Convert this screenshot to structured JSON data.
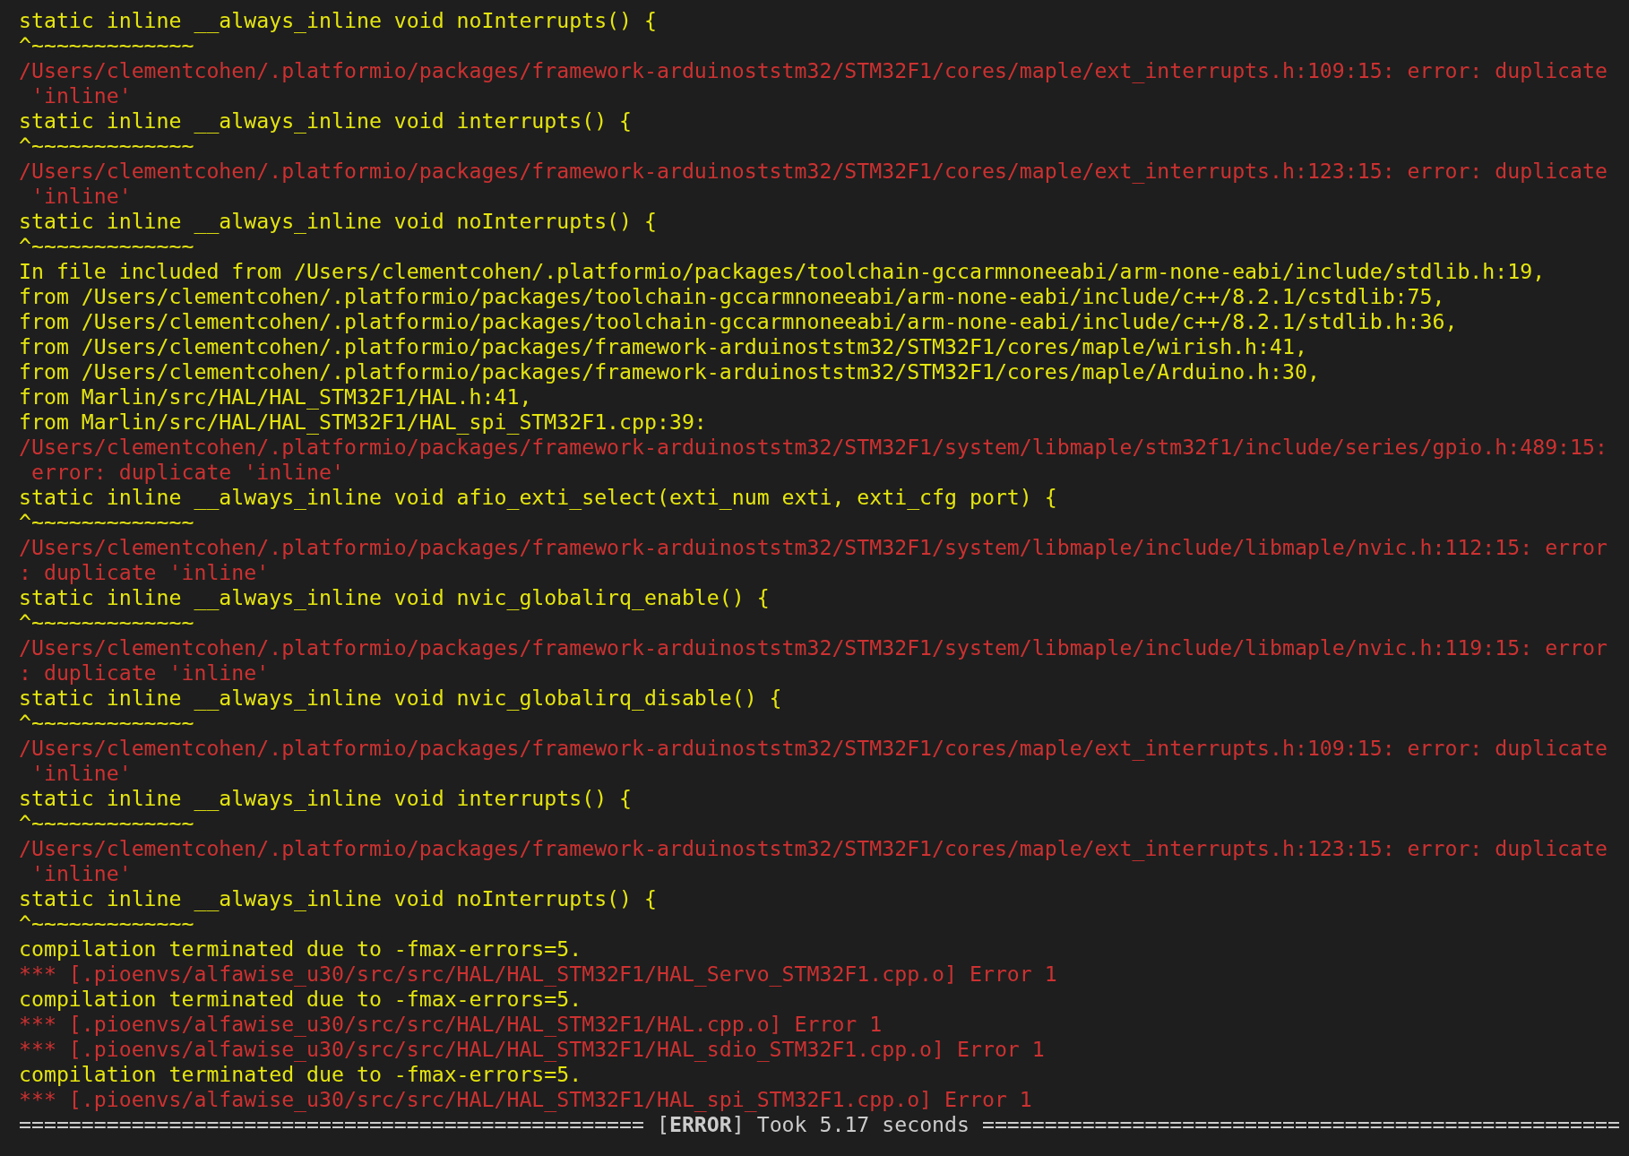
{
  "terminal": {
    "lines": [
      {
        "kind": "code",
        "text": "static inline __always_inline void noInterrupts() {"
      },
      {
        "kind": "code",
        "text": "^~~~~~~~~~~~~~"
      },
      {
        "kind": "error",
        "text": "/Users/clementcohen/.platformio/packages/framework-arduinoststm32/STM32F1/cores/maple/ext_interrupts.h:109:15: error: duplicate"
      },
      {
        "kind": "error",
        "text": " 'inline'"
      },
      {
        "kind": "code",
        "text": "static inline __always_inline void interrupts() {"
      },
      {
        "kind": "code",
        "text": "^~~~~~~~~~~~~~"
      },
      {
        "kind": "error",
        "text": "/Users/clementcohen/.platformio/packages/framework-arduinoststm32/STM32F1/cores/maple/ext_interrupts.h:123:15: error: duplicate"
      },
      {
        "kind": "error",
        "text": " 'inline'"
      },
      {
        "kind": "code",
        "text": "static inline __always_inline void noInterrupts() {"
      },
      {
        "kind": "code",
        "text": "^~~~~~~~~~~~~~"
      },
      {
        "kind": "code",
        "text": "In file included from /Users/clementcohen/.platformio/packages/toolchain-gccarmnoneeabi/arm-none-eabi/include/stdlib.h:19,"
      },
      {
        "kind": "code",
        "text": "from /Users/clementcohen/.platformio/packages/toolchain-gccarmnoneeabi/arm-none-eabi/include/c++/8.2.1/cstdlib:75,"
      },
      {
        "kind": "code",
        "text": "from /Users/clementcohen/.platformio/packages/toolchain-gccarmnoneeabi/arm-none-eabi/include/c++/8.2.1/stdlib.h:36,"
      },
      {
        "kind": "code",
        "text": "from /Users/clementcohen/.platformio/packages/framework-arduinoststm32/STM32F1/cores/maple/wirish.h:41,"
      },
      {
        "kind": "code",
        "text": "from /Users/clementcohen/.platformio/packages/framework-arduinoststm32/STM32F1/cores/maple/Arduino.h:30,"
      },
      {
        "kind": "code",
        "text": "from Marlin/src/HAL/HAL_STM32F1/HAL.h:41,"
      },
      {
        "kind": "code",
        "text": "from Marlin/src/HAL/HAL_STM32F1/HAL_spi_STM32F1.cpp:39:"
      },
      {
        "kind": "error",
        "text": "/Users/clementcohen/.platformio/packages/framework-arduinoststm32/STM32F1/system/libmaple/stm32f1/include/series/gpio.h:489:15:"
      },
      {
        "kind": "error",
        "text": " error: duplicate 'inline'"
      },
      {
        "kind": "code",
        "text": "static inline __always_inline void afio_exti_select(exti_num exti, exti_cfg port) {"
      },
      {
        "kind": "code",
        "text": "^~~~~~~~~~~~~~"
      },
      {
        "kind": "error",
        "text": "/Users/clementcohen/.platformio/packages/framework-arduinoststm32/STM32F1/system/libmaple/include/libmaple/nvic.h:112:15: error"
      },
      {
        "kind": "error",
        "text": ": duplicate 'inline'"
      },
      {
        "kind": "code",
        "text": "static inline __always_inline void nvic_globalirq_enable() {"
      },
      {
        "kind": "code",
        "text": "^~~~~~~~~~~~~~"
      },
      {
        "kind": "error",
        "text": "/Users/clementcohen/.platformio/packages/framework-arduinoststm32/STM32F1/system/libmaple/include/libmaple/nvic.h:119:15: error"
      },
      {
        "kind": "error",
        "text": ": duplicate 'inline'"
      },
      {
        "kind": "code",
        "text": "static inline __always_inline void nvic_globalirq_disable() {"
      },
      {
        "kind": "code",
        "text": "^~~~~~~~~~~~~~"
      },
      {
        "kind": "error",
        "text": "/Users/clementcohen/.platformio/packages/framework-arduinoststm32/STM32F1/cores/maple/ext_interrupts.h:109:15: error: duplicate"
      },
      {
        "kind": "error",
        "text": " 'inline'"
      },
      {
        "kind": "code",
        "text": "static inline __always_inline void interrupts() {"
      },
      {
        "kind": "code",
        "text": "^~~~~~~~~~~~~~"
      },
      {
        "kind": "error",
        "text": "/Users/clementcohen/.platformio/packages/framework-arduinoststm32/STM32F1/cores/maple/ext_interrupts.h:123:15: error: duplicate"
      },
      {
        "kind": "error",
        "text": " 'inline'"
      },
      {
        "kind": "code",
        "text": "static inline __always_inline void noInterrupts() {"
      },
      {
        "kind": "code",
        "text": "^~~~~~~~~~~~~~"
      },
      {
        "kind": "code",
        "text": "compilation terminated due to -fmax-errors=5."
      },
      {
        "kind": "error",
        "text": "*** [.pioenvs/alfawise_u30/src/src/HAL/HAL_STM32F1/HAL_Servo_STM32F1.cpp.o] Error 1"
      },
      {
        "kind": "code",
        "text": "compilation terminated due to -fmax-errors=5."
      },
      {
        "kind": "error",
        "text": "*** [.pioenvs/alfawise_u30/src/src/HAL/HAL_STM32F1/HAL.cpp.o] Error 1"
      },
      {
        "kind": "error",
        "text": "*** [.pioenvs/alfawise_u30/src/src/HAL/HAL_STM32F1/HAL_sdio_STM32F1.cpp.o] Error 1"
      },
      {
        "kind": "code",
        "text": "compilation terminated due to -fmax-errors=5."
      },
      {
        "kind": "error",
        "text": "*** [.pioenvs/alfawise_u30/src/src/HAL/HAL_STM32F1/HAL_spi_STM32F1.cpp.o] Error 1"
      },
      {
        "kind": "summary",
        "text": "================================================== [**ERROR**] Took 5.17 seconds ==================================================="
      }
    ]
  }
}
